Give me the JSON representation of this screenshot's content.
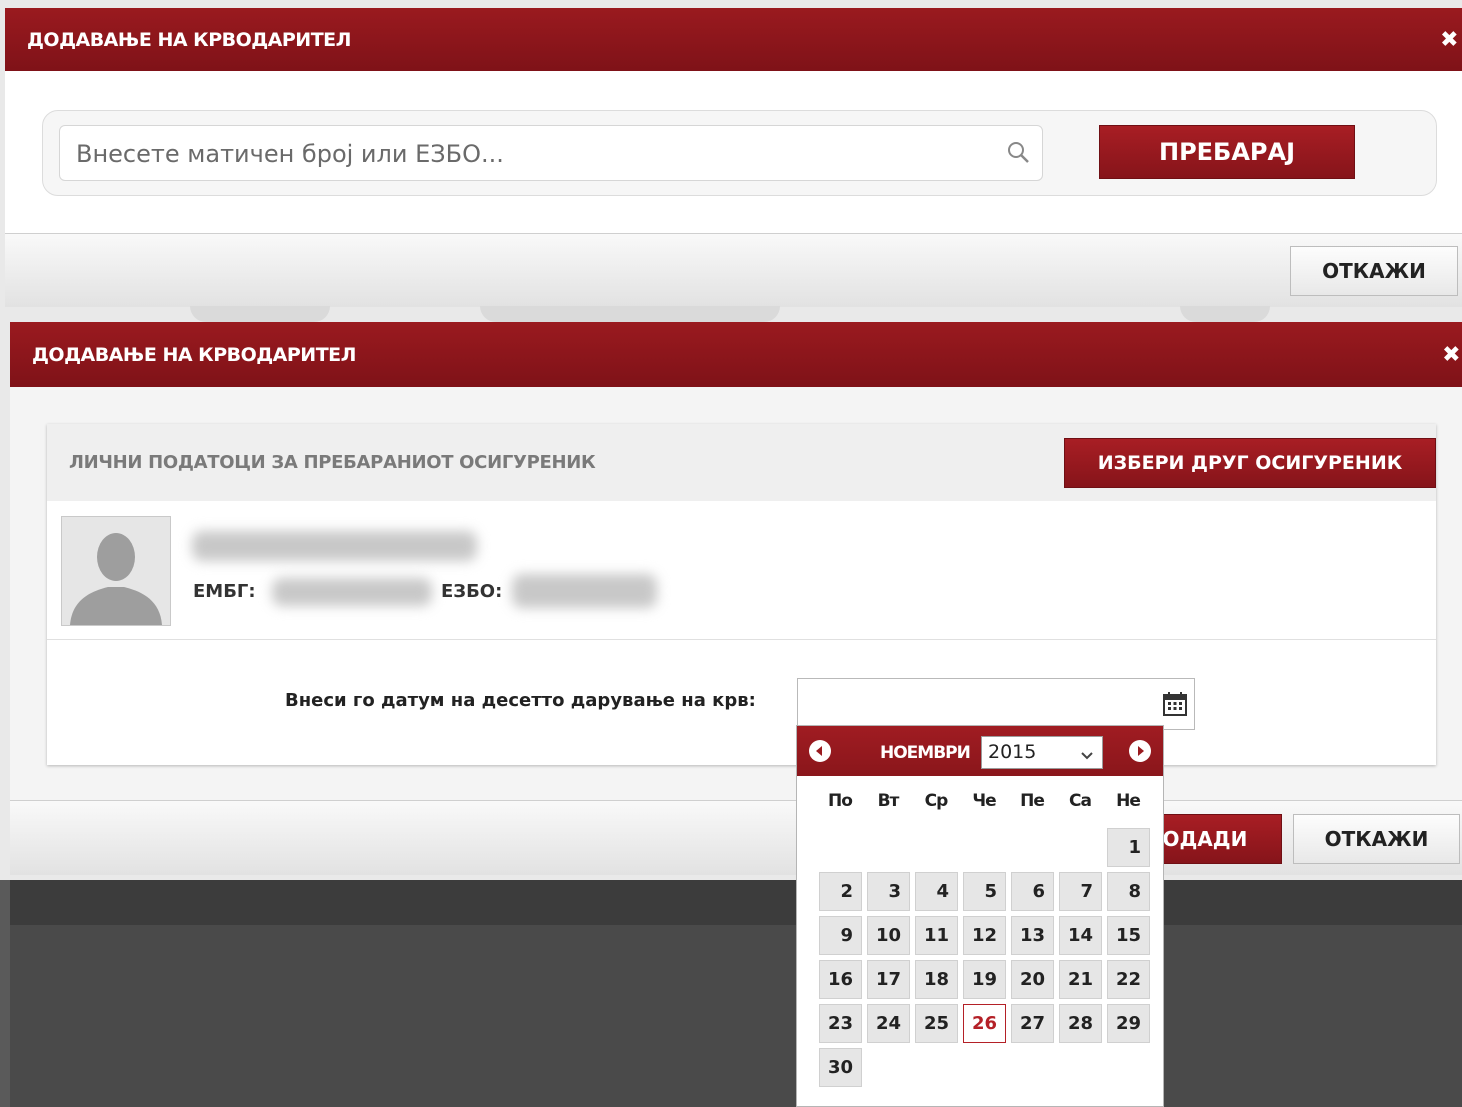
{
  "dialog1": {
    "title": "ДОДАВАЊЕ НА КРВОДАРИТЕЛ",
    "close": "✖",
    "search_placeholder": "Внесете матичен број или ЕЗБО...",
    "search_button": "ПРЕБАРАЈ",
    "cancel_button": "ОТКАЖИ"
  },
  "dialog2": {
    "title": "ДОДАВАЊЕ НА КРВОДАРИТЕЛ",
    "close": "✖",
    "section_label": "ЛИЧНИ ПОДАТОЦИ ЗА ПРЕБАРАНИОТ ОСИГУРЕНИК",
    "other_button": "ИЗБЕРИ ДРУГ ОСИГУРЕНИК",
    "emb_label": "ЕМБГ:",
    "ezbo_label": "ЕЗБО:",
    "date_label": "Внеси го датум на десетто дарување на крв:",
    "add_button": "ДОДАДИ",
    "cancel_button": "ОТКАЖИ"
  },
  "calendar": {
    "month": "НОЕМВРИ",
    "year": "2015",
    "weekdays": [
      "По",
      "Вт",
      "Ср",
      "Че",
      "Пе",
      "Са",
      "Не"
    ],
    "weeks": [
      [
        "",
        "",
        "",
        "",
        "",
        "",
        "1"
      ],
      [
        "2",
        "3",
        "4",
        "5",
        "6",
        "7",
        "8"
      ],
      [
        "9",
        "10",
        "11",
        "12",
        "13",
        "14",
        "15"
      ],
      [
        "16",
        "17",
        "18",
        "19",
        "20",
        "21",
        "22"
      ],
      [
        "23",
        "24",
        "25",
        "26",
        "27",
        "28",
        "29"
      ],
      [
        "30",
        "",
        "",
        "",
        "",
        "",
        ""
      ]
    ],
    "today": "26",
    "accent_color": "#9a1a1f"
  }
}
